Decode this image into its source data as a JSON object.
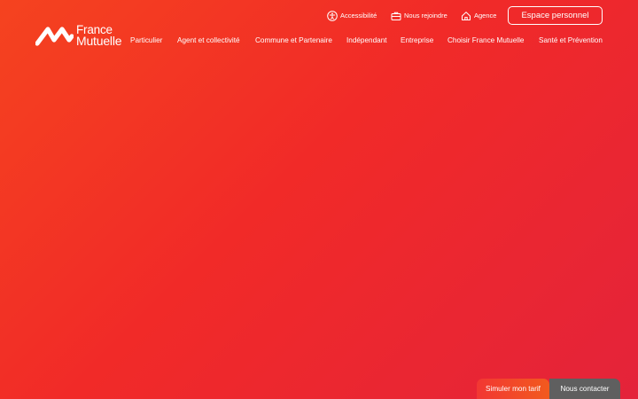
{
  "brand": {
    "line1": "France",
    "line2": "Mutuelle"
  },
  "utility": {
    "accessibility": "Accessibilité",
    "join": "Nous rejoindre",
    "agency": "Agence",
    "account_button": "Espace personnel"
  },
  "nav": {
    "items": [
      {
        "label": "Particulier"
      },
      {
        "label": "Agent et collectivité"
      },
      {
        "label": "Commune et Partenaire"
      },
      {
        "label": "Indépendant"
      },
      {
        "label": "Entreprise"
      },
      {
        "label": "Choisir France Mutuelle"
      },
      {
        "label": "Santé et Prévention"
      }
    ]
  },
  "cta": {
    "simulate": "Simuler mon tarif",
    "contact": "Nous contacter"
  },
  "icons": [
    "brand-logo-icon",
    "accessibility-icon",
    "briefcase-icon",
    "home-icon"
  ],
  "colors": {
    "background_start": "#f5431f",
    "background_end": "#e4233a",
    "contact_button": "#5f5f5f"
  }
}
